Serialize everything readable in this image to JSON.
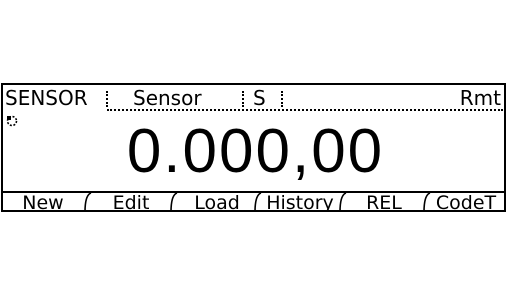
{
  "status": {
    "mode": "SENSOR",
    "sensor_label": "Sensor",
    "unit": "S",
    "remote": "Rmt"
  },
  "reading": {
    "value": "0.000,00"
  },
  "icons": {
    "trigger_indicator": "trigger-indicator-icon"
  },
  "softkeys": [
    {
      "label": "New"
    },
    {
      "label": "Edit"
    },
    {
      "label": "Load"
    },
    {
      "label": "History"
    },
    {
      "label": "REL"
    },
    {
      "label": "CodeT"
    }
  ]
}
